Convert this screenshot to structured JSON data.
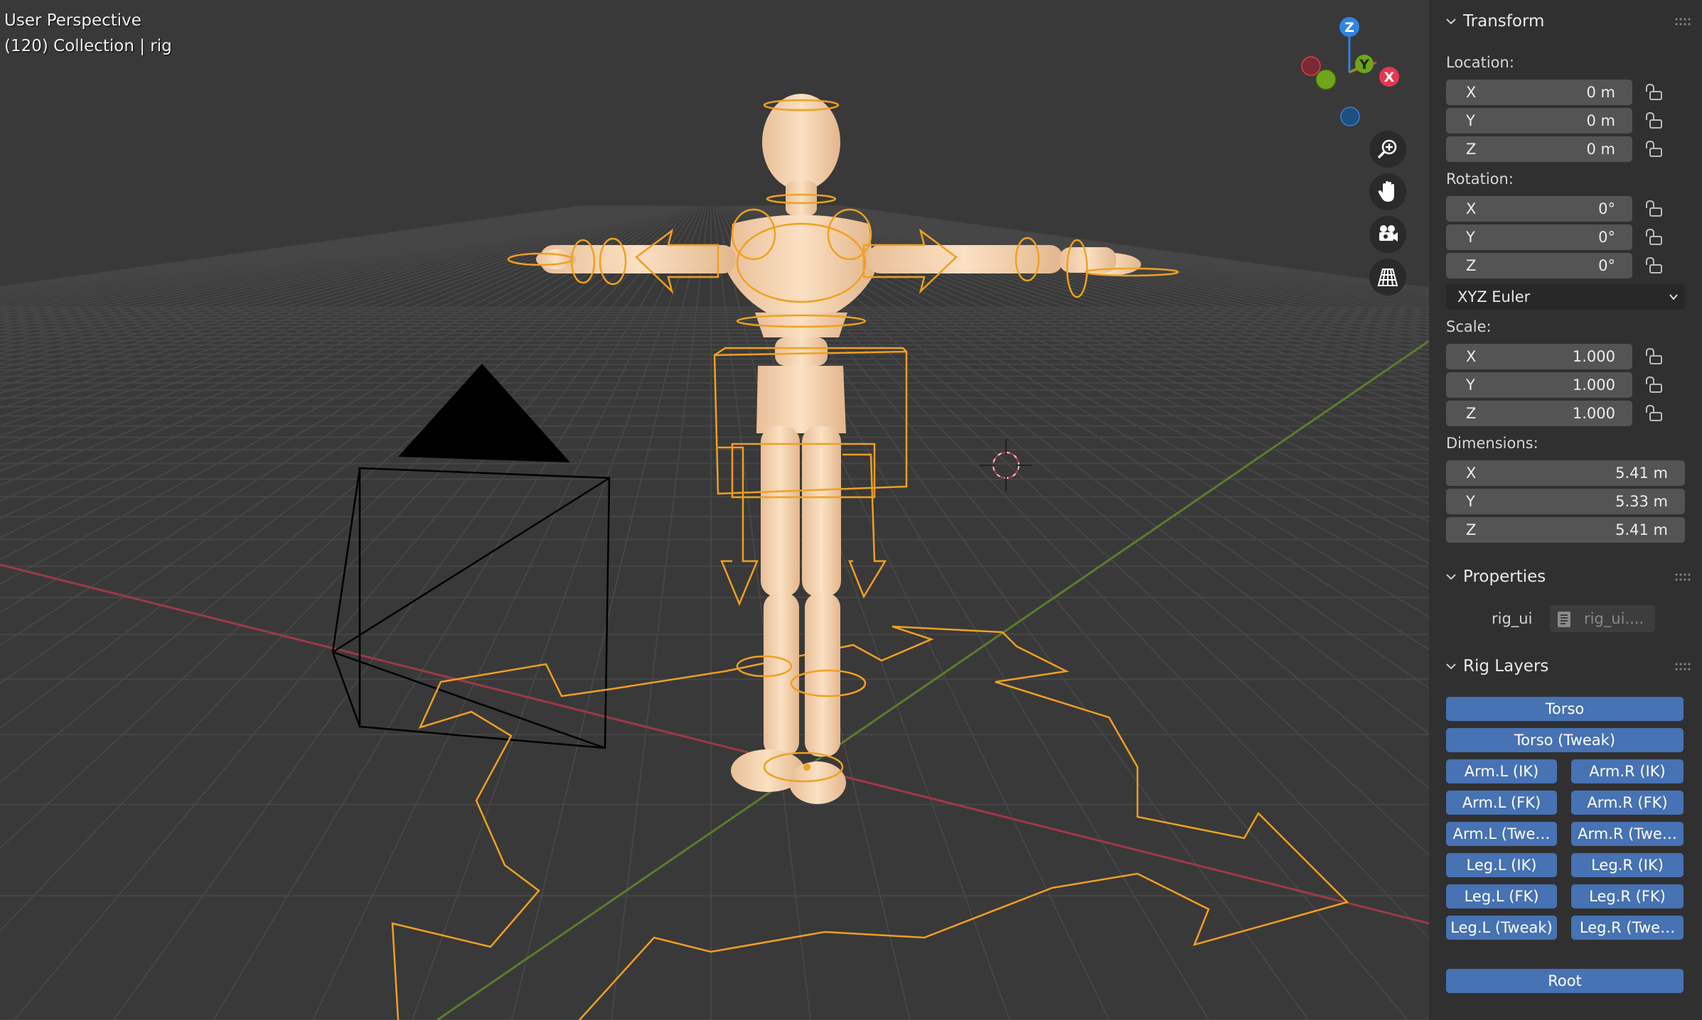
{
  "viewport": {
    "title": "User Perspective",
    "subtitle": "(120) Collection | rig",
    "gizmo_axes": [
      "Z",
      "Y",
      "X"
    ],
    "nav_icons": [
      "zoom-icon",
      "hand-pan-icon",
      "camera-icon",
      "grid-perspective-icon"
    ],
    "colors": {
      "x_axis": "#f0364f",
      "y_axis": "#6ea51b",
      "z_axis": "#2f83e2",
      "selection": "#f0a020"
    }
  },
  "transform": {
    "title": "Transform",
    "location_label": "Location:",
    "location": [
      {
        "axis": "X",
        "value": "0 m"
      },
      {
        "axis": "Y",
        "value": "0 m"
      },
      {
        "axis": "Z",
        "value": "0 m"
      }
    ],
    "rotation_label": "Rotation:",
    "rotation": [
      {
        "axis": "X",
        "value": "0°"
      },
      {
        "axis": "Y",
        "value": "0°"
      },
      {
        "axis": "Z",
        "value": "0°"
      }
    ],
    "rotation_mode": "XYZ Euler",
    "scale_label": "Scale:",
    "scale": [
      {
        "axis": "X",
        "value": "1.000"
      },
      {
        "axis": "Y",
        "value": "1.000"
      },
      {
        "axis": "Z",
        "value": "1.000"
      }
    ],
    "dimensions_label": "Dimensions:",
    "dimensions": [
      {
        "axis": "X",
        "value": "5.41 m"
      },
      {
        "axis": "Y",
        "value": "5.33 m"
      },
      {
        "axis": "Z",
        "value": "5.41 m"
      }
    ]
  },
  "properties": {
    "title": "Properties",
    "label": "rig_ui",
    "value": "rig_ui...."
  },
  "rig_layers": {
    "title": "Rig Layers",
    "torso": "Torso",
    "torso_tweak": "Torso (Tweak)",
    "arm_l_ik": "Arm.L (IK)",
    "arm_r_ik": "Arm.R (IK)",
    "arm_l_fk": "Arm.L (FK)",
    "arm_r_fk": "Arm.R (FK)",
    "arm_l_tweak": "Arm.L (Twe…",
    "arm_r_tweak": "Arm.R (Twe…",
    "leg_l_ik": "Leg.L (IK)",
    "leg_r_ik": "Leg.R (IK)",
    "leg_l_fk": "Leg.L (FK)",
    "leg_r_fk": "Leg.R (FK)",
    "leg_l_tweak": "Leg.L (Tweak)",
    "leg_r_tweak": "Leg.R (Twe…",
    "root": "Root"
  }
}
